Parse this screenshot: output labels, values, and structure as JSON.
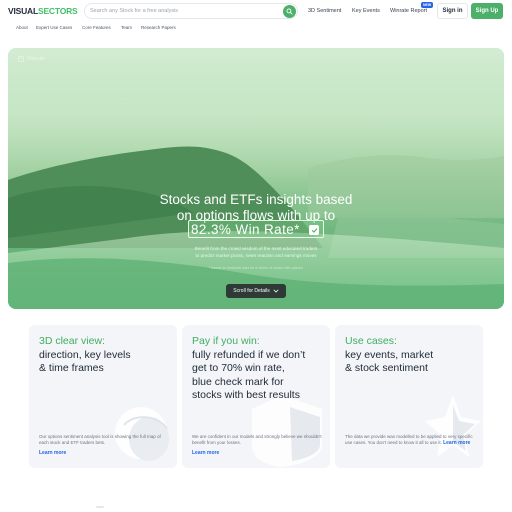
{
  "header": {
    "logo_part1": "VISUAL",
    "logo_part2": "SECTORS",
    "search_placeholder": "Search any Stock for a free analysis",
    "nav": [
      "3D Sentiment",
      "Key Events",
      "Winrate Report"
    ],
    "new_badge": "NEW",
    "signin": "Sign in",
    "signup": "Sign Up"
  },
  "subnav": [
    "About",
    "Expert Use Cases",
    "Core Features",
    "Team",
    "Research Papers"
  ],
  "hero": {
    "tag": "Website",
    "title_line1": "Stocks and ETFs insights based",
    "title_line2": "on options flows with up to",
    "winrate": "82.3% Win Rate*",
    "desc_line1": "Benefit from the crowd wisdom of the most educated traders",
    "desc_line2": "to predict market pivots, news reaction and earnings moves",
    "note": "* based on historical data for a series of stocks with options",
    "scroll_label": "Scroll for Details"
  },
  "cards": [
    {
      "title_green": "3D clear view:",
      "title_dark": [
        "direction, key levels",
        "& time frames"
      ],
      "text": "Our options sentiment analysis tool is showing the full map of each stock and ETF traders bets.",
      "link": "Learn more"
    },
    {
      "title_green": "Pay if you win:",
      "title_dark": [
        "fully refunded if we don’t",
        "get to 70% win rate,",
        "blue check mark for",
        "stocks with best results"
      ],
      "text": "We are confident in our models and strongly believe we shouldn't benefit from your losses.",
      "link": "Learn more"
    },
    {
      "title_green": "Use cases:",
      "title_dark": [
        "key events, market",
        "& stock sentiment"
      ],
      "text": "The data we provide was modelled to be applied to very specific use cases. You don’t need to know it all to use it.",
      "link": "Learn more"
    }
  ],
  "colors": {
    "brand_green": "#4caf6a",
    "link_blue": "#2563eb",
    "dark_button": "#2f3a36"
  },
  "icons": {
    "search": "search-icon",
    "check": "check-icon",
    "chevron": "chevron-down-icon"
  }
}
